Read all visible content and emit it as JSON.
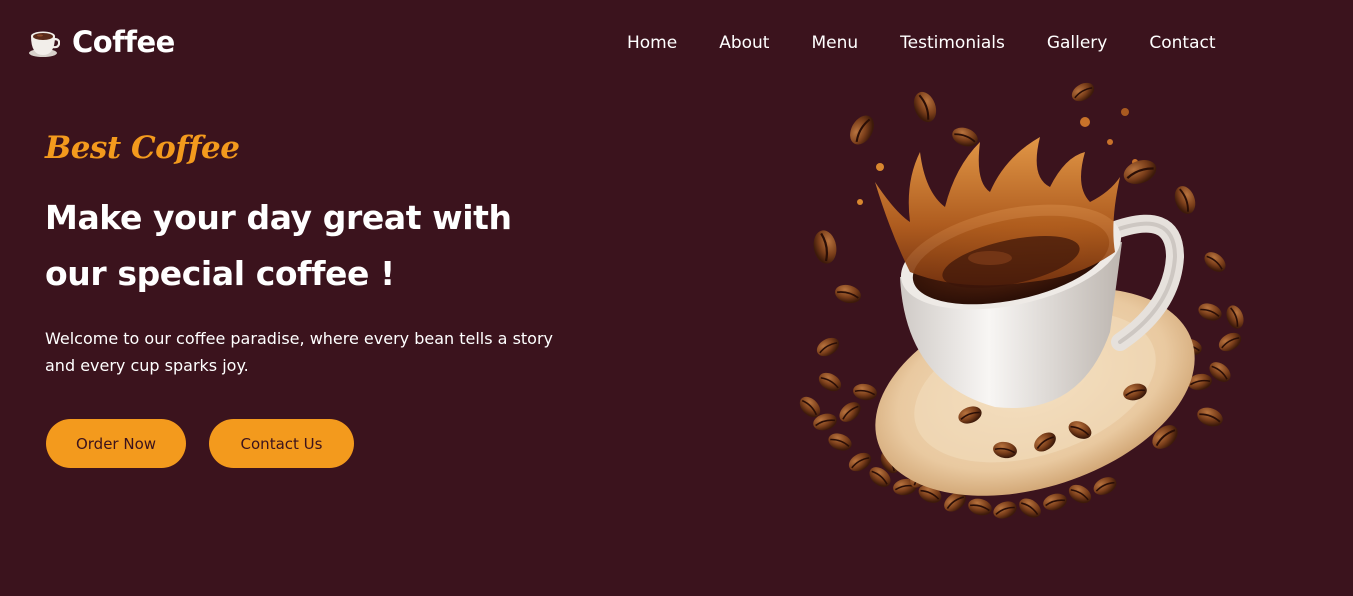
{
  "brand": {
    "name": "Coffee",
    "logo_icon": "coffee-cup-icon"
  },
  "nav": {
    "items": [
      "Home",
      "About",
      "Menu",
      "Testimonials",
      "Gallery",
      "Contact"
    ]
  },
  "hero": {
    "tagline": "Best Coffee",
    "headline_line1": "Make your day great with",
    "headline_line2": "our special coffee !",
    "description": "Welcome to our coffee paradise, where every bean tells a story and every cup sparks joy.",
    "buttons": {
      "order": "Order Now",
      "contact": "Contact Us"
    },
    "image_icon": "coffee-splash-illustration"
  },
  "colors": {
    "background": "#3b131d",
    "accent": "#f39a1d",
    "text": "#ffffff"
  }
}
